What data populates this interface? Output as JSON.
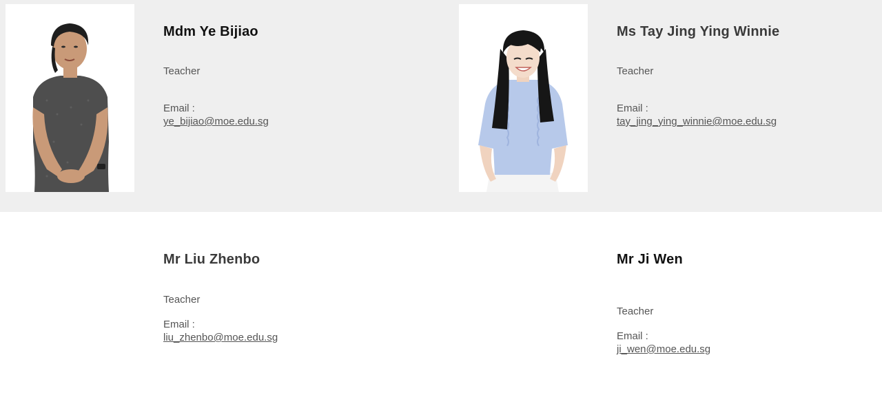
{
  "staff": [
    {
      "name": "Mdm Ye Bijiao",
      "role": "Teacher",
      "email_label": "Email :",
      "email": "ye_bijiao@moe.edu.sg",
      "photo": "staff-photo"
    },
    {
      "name": "Ms Tay Jing Ying Winnie",
      "role": "Teacher",
      "email_label": "Email :",
      "email": "tay_jing_ying_winnie@moe.edu.sg",
      "photo": "staff-photo"
    },
    {
      "name": "Mr Liu Zhenbo",
      "role": "Teacher",
      "email_label": "Email :",
      "email": "liu_zhenbo@moe.edu.sg"
    },
    {
      "name": "Mr Ji Wen",
      "role": "Teacher",
      "email_label": "Email :",
      "email": "ji_wen@moe.edu.sg"
    }
  ],
  "colors": {
    "top_band": "#efefef",
    "text": "#555555",
    "heading": "#111111"
  }
}
